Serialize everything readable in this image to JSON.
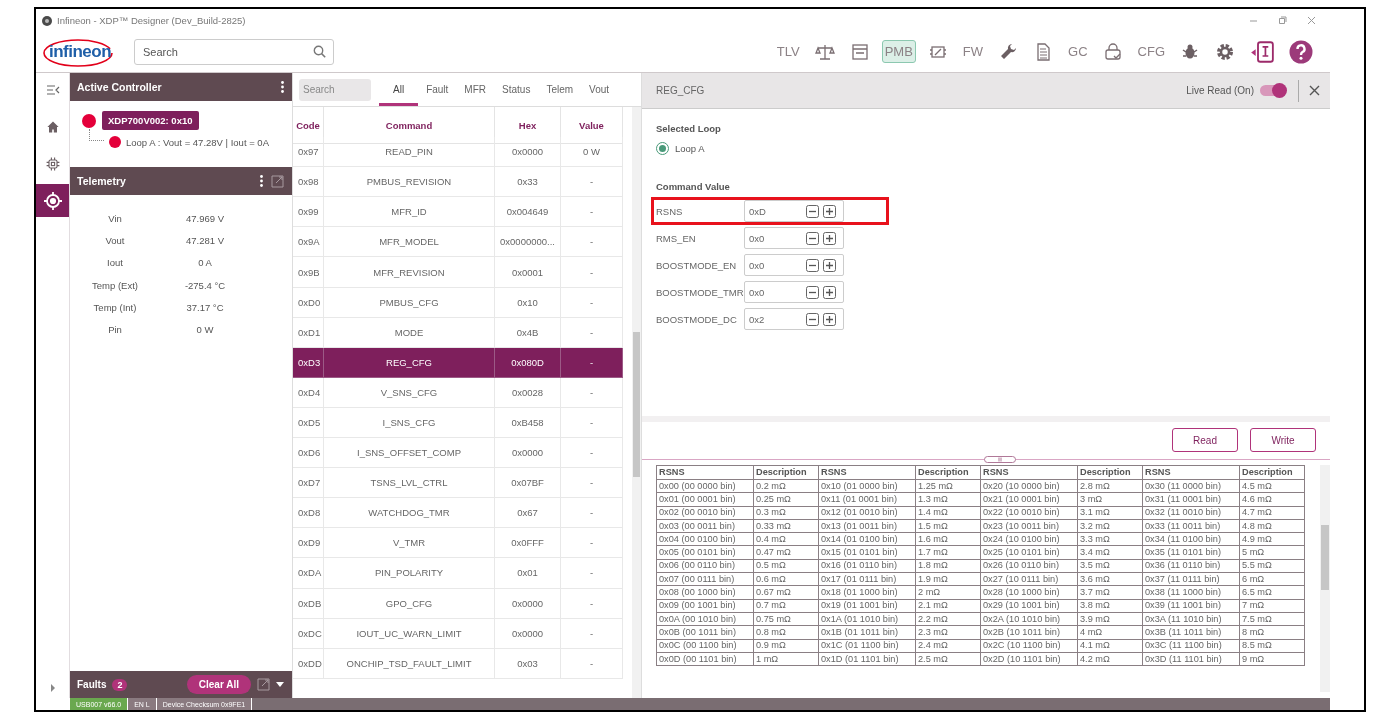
{
  "window": {
    "title": "Infineon - XDP™ Designer (Dev_Build-2825)"
  },
  "header": {
    "logo": "infineon",
    "search": {
      "placeholder": "Search"
    },
    "toolbar": [
      {
        "kind": "text",
        "label": "TLV",
        "selected": false
      },
      {
        "kind": "scale",
        "selected": false
      },
      {
        "kind": "board",
        "selected": false
      },
      {
        "kind": "text",
        "label": "PMB",
        "selected": true
      },
      {
        "kind": "chipedit",
        "selected": false
      },
      {
        "kind": "text",
        "label": "FW",
        "selected": false
      },
      {
        "kind": "wrench",
        "selected": false
      },
      {
        "kind": "document",
        "selected": false
      },
      {
        "kind": "text",
        "label": "GC",
        "selected": false
      },
      {
        "kind": "lock",
        "selected": false
      },
      {
        "kind": "text",
        "label": "CFG",
        "selected": false
      },
      {
        "kind": "bug",
        "selected": false
      },
      {
        "kind": "gear",
        "selected": false
      },
      {
        "kind": "info",
        "selected": false
      },
      {
        "kind": "help",
        "selected": false
      }
    ]
  },
  "nav_rail": [
    {
      "kind": "home",
      "selected": false
    },
    {
      "kind": "chip",
      "selected": false
    },
    {
      "kind": "target",
      "selected": true
    }
  ],
  "active_controller": {
    "title": "Active Controller",
    "device": "XDP700V002: 0x10",
    "loop": "Loop A : Vout = 47.28V | Iout = 0A"
  },
  "telemetry": {
    "title": "Telemetry",
    "rows": [
      {
        "label": "Vin",
        "value": "47.969 V"
      },
      {
        "label": "Vout",
        "value": "47.281 V"
      },
      {
        "label": "Iout",
        "value": "0 A"
      },
      {
        "label": "Temp (Ext)",
        "value": "-275.4 °C"
      },
      {
        "label": "Temp (Int)",
        "value": "37.17 °C"
      },
      {
        "label": "Pin",
        "value": "0 W"
      }
    ]
  },
  "faults": {
    "title": "Faults",
    "count": "2",
    "clear_button": "Clear All"
  },
  "status_bar": [
    {
      "text": "USB007 v66.0",
      "color": "#6aa84f"
    },
    {
      "text": "EN L",
      "color": "#8a7a80"
    },
    {
      "text": "Device Checksum 0x9FE1",
      "color": "#8a7a80"
    }
  ],
  "commands": {
    "search": {
      "placeholder": "Search"
    },
    "tabs": [
      {
        "label": "All",
        "selected": true
      },
      {
        "label": "Fault",
        "selected": false
      },
      {
        "label": "MFR",
        "selected": false
      },
      {
        "label": "Status",
        "selected": false
      },
      {
        "label": "Telem",
        "selected": false
      },
      {
        "label": "Vout",
        "selected": false
      }
    ],
    "columns": [
      "Code",
      "Command",
      "Hex",
      "Value"
    ],
    "rows": [
      {
        "code": "0x97",
        "command": "READ_PIN",
        "hex": "0x0000",
        "value": "0 W",
        "selected": false
      },
      {
        "code": "0x98",
        "command": "PMBUS_REVISION",
        "hex": "0x33",
        "value": "-",
        "selected": false
      },
      {
        "code": "0x99",
        "command": "MFR_ID",
        "hex": "0x004649",
        "value": "-",
        "selected": false
      },
      {
        "code": "0x9A",
        "command": "MFR_MODEL",
        "hex": "0x0000000...",
        "value": "-",
        "selected": false
      },
      {
        "code": "0x9B",
        "command": "MFR_REVISION",
        "hex": "0x0001",
        "value": "-",
        "selected": false
      },
      {
        "code": "0xD0",
        "command": "PMBUS_CFG",
        "hex": "0x10",
        "value": "-",
        "selected": false
      },
      {
        "code": "0xD1",
        "command": "MODE",
        "hex": "0x4B",
        "value": "-",
        "selected": false
      },
      {
        "code": "0xD3",
        "command": "REG_CFG",
        "hex": "0x080D",
        "value": "-",
        "selected": true
      },
      {
        "code": "0xD4",
        "command": "V_SNS_CFG",
        "hex": "0x0028",
        "value": "-",
        "selected": false
      },
      {
        "code": "0xD5",
        "command": "I_SNS_CFG",
        "hex": "0xB458",
        "value": "-",
        "selected": false
      },
      {
        "code": "0xD6",
        "command": "I_SNS_OFFSET_COMP",
        "hex": "0x0000",
        "value": "-",
        "selected": false
      },
      {
        "code": "0xD7",
        "command": "TSNS_LVL_CTRL",
        "hex": "0x07BF",
        "value": "-",
        "selected": false
      },
      {
        "code": "0xD8",
        "command": "WATCHDOG_TMR",
        "hex": "0x67",
        "value": "-",
        "selected": false
      },
      {
        "code": "0xD9",
        "command": "V_TMR",
        "hex": "0x0FFF",
        "value": "-",
        "selected": false
      },
      {
        "code": "0xDA",
        "command": "PIN_POLARITY",
        "hex": "0x01",
        "value": "-",
        "selected": false
      },
      {
        "code": "0xDB",
        "command": "GPO_CFG",
        "hex": "0x0000",
        "value": "-",
        "selected": false
      },
      {
        "code": "0xDC",
        "command": "IOUT_UC_WARN_LIMIT",
        "hex": "0x0000",
        "value": "-",
        "selected": false
      },
      {
        "code": "0xDD",
        "command": "ONCHIP_TSD_FAULT_LIMIT",
        "hex": "0x03",
        "value": "-",
        "selected": false
      }
    ]
  },
  "detail": {
    "title": "REG_CFG",
    "live_read": {
      "label": "Live Read (On)",
      "on": true
    },
    "selected_loop": {
      "title": "Selected Loop",
      "options": [
        {
          "label": "Loop A",
          "selected": true
        }
      ]
    },
    "command_value": {
      "title": "Command Value",
      "fields": [
        {
          "label": "RSNS",
          "value": "0xD",
          "highlighted": true
        },
        {
          "label": "RMS_EN",
          "value": "0x0",
          "highlighted": false
        },
        {
          "label": "BOOSTMODE_EN",
          "value": "0x0",
          "highlighted": false
        },
        {
          "label": "BOOSTMODE_TMR",
          "value": "0x0",
          "highlighted": false
        },
        {
          "label": "BOOSTMODE_DC",
          "value": "0x2",
          "highlighted": false
        }
      ]
    },
    "buttons": [
      "Read",
      "Write"
    ],
    "table": {
      "columns": [
        "RSNS",
        "Description",
        "RSNS",
        "Description",
        "RSNS",
        "Description",
        "RSNS",
        "Description"
      ],
      "rows": [
        [
          "0x00 (00 0000 bin)",
          "0.2 mΩ",
          "0x10 (01 0000 bin)",
          "1.25 mΩ",
          "0x20 (10 0000 bin)",
          "2.8 mΩ",
          "0x30 (11 0000 bin)",
          "4.5 mΩ"
        ],
        [
          "0x01 (00 0001 bin)",
          "0.25 mΩ",
          "0x11 (01 0001 bin)",
          "1.3 mΩ",
          "0x21 (10 0001 bin)",
          "3 mΩ",
          "0x31 (11 0001 bin)",
          "4.6 mΩ"
        ],
        [
          "0x02 (00 0010 bin)",
          "0.3 mΩ",
          "0x12 (01 0010 bin)",
          "1.4 mΩ",
          "0x22 (10 0010 bin)",
          "3.1 mΩ",
          "0x32 (11 0010 bin)",
          "4.7 mΩ"
        ],
        [
          "0x03 (00 0011 bin)",
          "0.33 mΩ",
          "0x13 (01 0011 bin)",
          "1.5 mΩ",
          "0x23 (10 0011 bin)",
          "3.2 mΩ",
          "0x33 (11 0011 bin)",
          "4.8 mΩ"
        ],
        [
          "0x04 (00 0100 bin)",
          "0.4 mΩ",
          "0x14 (01 0100 bin)",
          "1.6 mΩ",
          "0x24 (10 0100 bin)",
          "3.3 mΩ",
          "0x34 (11 0100 bin)",
          "4.9 mΩ"
        ],
        [
          "0x05 (00 0101 bin)",
          "0.47 mΩ",
          "0x15 (01 0101 bin)",
          "1.7 mΩ",
          "0x25 (10 0101 bin)",
          "3.4 mΩ",
          "0x35 (11 0101 bin)",
          "5 mΩ"
        ],
        [
          "0x06 (00 0110 bin)",
          "0.5 mΩ",
          "0x16 (01 0110 bin)",
          "1.8 mΩ",
          "0x26 (10 0110 bin)",
          "3.5 mΩ",
          "0x36 (11 0110 bin)",
          "5.5 mΩ"
        ],
        [
          "0x07 (00 0111 bin)",
          "0.6 mΩ",
          "0x17 (01 0111 bin)",
          "1.9 mΩ",
          "0x27 (10 0111 bin)",
          "3.6 mΩ",
          "0x37 (11 0111 bin)",
          "6 mΩ"
        ],
        [
          "0x08 (00 1000 bin)",
          "0.67 mΩ",
          "0x18 (01 1000 bin)",
          "2 mΩ",
          "0x28 (10 1000 bin)",
          "3.7 mΩ",
          "0x38 (11 1000 bin)",
          "6.5 mΩ"
        ],
        [
          "0x09 (00 1001 bin)",
          "0.7 mΩ",
          "0x19 (01 1001 bin)",
          "2.1 mΩ",
          "0x29 (10 1001 bin)",
          "3.8 mΩ",
          "0x39 (11 1001 bin)",
          "7 mΩ"
        ],
        [
          "0x0A (00 1010 bin)",
          "0.75 mΩ",
          "0x1A (01 1010 bin)",
          "2.2 mΩ",
          "0x2A (10 1010 bin)",
          "3.9 mΩ",
          "0x3A (11 1010 bin)",
          "7.5 mΩ"
        ],
        [
          "0x0B (00 1011 bin)",
          "0.8 mΩ",
          "0x1B (01 1011 bin)",
          "2.3 mΩ",
          "0x2B (10 1011 bin)",
          "4 mΩ",
          "0x3B (11 1011 bin)",
          "8 mΩ"
        ],
        [
          "0x0C (00 1100 bin)",
          "0.9 mΩ",
          "0x1C (01 1100 bin)",
          "2.4 mΩ",
          "0x2C (10 1100 bin)",
          "4.1 mΩ",
          "0x3C (11 1100 bin)",
          "8.5 mΩ"
        ],
        [
          "0x0D (00 1101 bin)",
          "1 mΩ",
          "0x1D (01 1101 bin)",
          "2.5 mΩ",
          "0x2D (10 1101 bin)",
          "4.2 mΩ",
          "0x3D (11 1101 bin)",
          "9 mΩ"
        ]
      ]
    }
  }
}
